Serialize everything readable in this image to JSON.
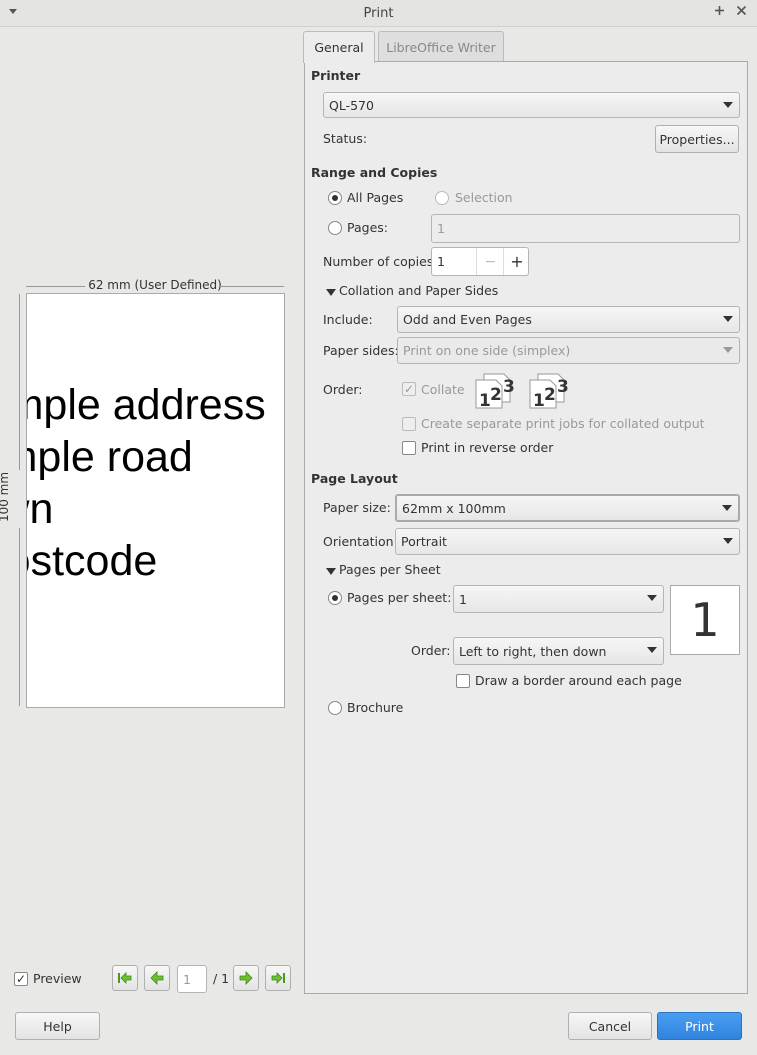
{
  "window": {
    "title": "Print"
  },
  "preview": {
    "width_label": "62 mm (User Defined)",
    "height_label": "100 mm",
    "lines": [
      "Sample address",
      "Sample road",
      "Town",
      "Postcode"
    ],
    "checkbox_label": "Preview",
    "page_value": "1",
    "page_total": "/ 1"
  },
  "tabs": [
    "General",
    "LibreOffice Writer"
  ],
  "printer": {
    "heading": "Printer",
    "selected": "QL-570",
    "status_label": "Status:",
    "properties_label": "Properties..."
  },
  "range": {
    "heading": "Range and Copies",
    "all_pages": "All Pages",
    "selection": "Selection",
    "pages": "Pages:",
    "pages_value": "1",
    "copies_label": "Number of copies:",
    "copies_value": "1",
    "minus": "−",
    "plus": "+"
  },
  "collation": {
    "heading": "Collation and Paper Sides",
    "include_label": "Include:",
    "include_value": "Odd and Even Pages",
    "sides_label": "Paper sides:",
    "sides_value": "Print on one side (simplex)",
    "order_label": "Order:",
    "collate": "Collate",
    "separate_jobs": "Create separate print jobs for collated output",
    "reverse": "Print in reverse order"
  },
  "layout": {
    "heading": "Page Layout",
    "size_label": "Paper size:",
    "size_value": "62mm x 100mm",
    "orient_label": "Orientation:",
    "orient_value": "Portrait"
  },
  "pps": {
    "heading": "Pages per Sheet",
    "label": "Pages per sheet:",
    "value": "1",
    "preview_num": "1",
    "order_label": "Order:",
    "order_value": "Left to right, then down",
    "border": "Draw a border around each page",
    "brochure": "Brochure"
  },
  "buttons": {
    "help": "Help",
    "cancel": "Cancel",
    "print": "Print"
  }
}
